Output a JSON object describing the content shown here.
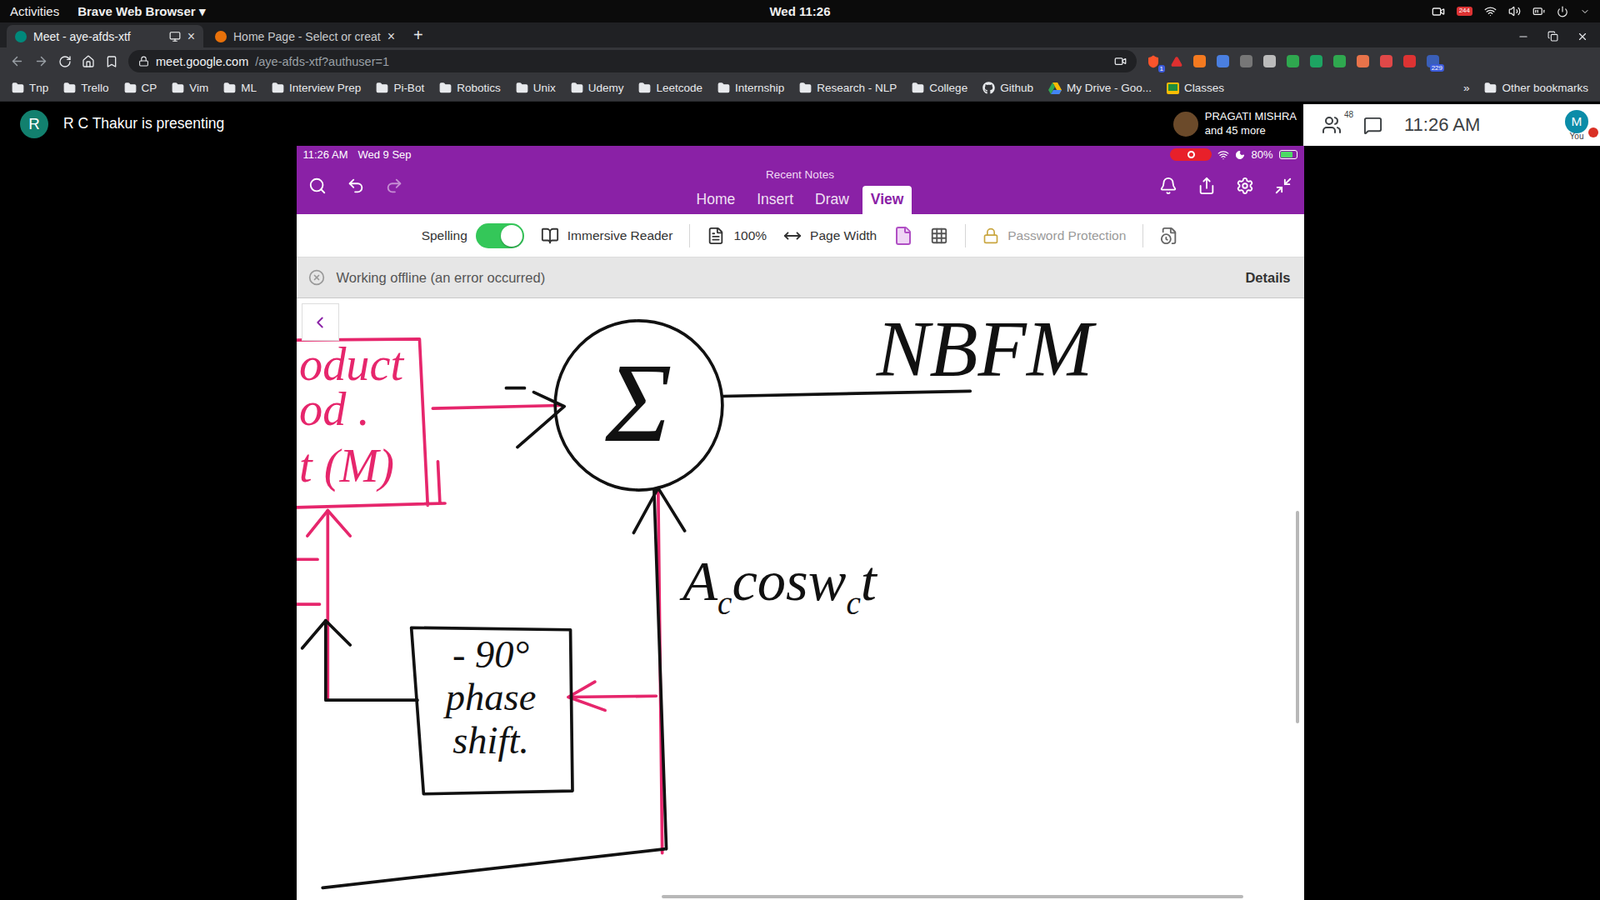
{
  "system_bar": {
    "activities": "Activities",
    "app_menu": "Brave Web Browser",
    "app_menu_arrow": "▾",
    "clock": "Wed 11:26",
    "notification_count": "244"
  },
  "browser": {
    "tabs": [
      {
        "label": "Meet - aye-afds-xtf",
        "selected": true,
        "close": "×"
      },
      {
        "label": "Home Page - Select or creat",
        "selected": false,
        "close": "×"
      }
    ],
    "new_tab": "+",
    "url": {
      "host": "meet.google.com",
      "path": "/aye-afds-xtf?authuser=1"
    },
    "shield_badge": "1",
    "extension_badge": "229",
    "bookmarks": [
      {
        "label": "Tnp",
        "kind": "folder"
      },
      {
        "label": "Trello",
        "kind": "folder"
      },
      {
        "label": "CP",
        "kind": "folder"
      },
      {
        "label": "Vim",
        "kind": "folder"
      },
      {
        "label": "ML",
        "kind": "folder"
      },
      {
        "label": "Interview Prep",
        "kind": "folder"
      },
      {
        "label": "Pi-Bot",
        "kind": "folder"
      },
      {
        "label": "Robotics",
        "kind": "folder"
      },
      {
        "label": "Unix",
        "kind": "folder"
      },
      {
        "label": "Udemy",
        "kind": "folder"
      },
      {
        "label": "Leetcode",
        "kind": "folder"
      },
      {
        "label": "Internship",
        "kind": "folder"
      },
      {
        "label": "Research - NLP",
        "kind": "folder"
      },
      {
        "label": "College",
        "kind": "folder"
      },
      {
        "label": "Github",
        "kind": "github"
      },
      {
        "label": "My Drive - Goo...",
        "kind": "drive"
      },
      {
        "label": "Classes",
        "kind": "classroom"
      }
    ],
    "overflow": "»",
    "other_bookmarks": "Other bookmarks"
  },
  "meet": {
    "presenter_initial": "R",
    "presenting": "R C Thakur is presenting",
    "participant_name": "PRAGATI MISHRA",
    "participant_more": "and 45 more",
    "people_count": "48",
    "clock": "11:26 AM",
    "self_initial": "M",
    "self_label": "You"
  },
  "onenote": {
    "status_time": "11:26 AM",
    "status_date": "Wed 9 Sep",
    "battery": "80%",
    "battery_level": 0.8,
    "notebook": "Recent Notes",
    "tabs": [
      {
        "label": "Home",
        "selected": false
      },
      {
        "label": "Insert",
        "selected": false
      },
      {
        "label": "Draw",
        "selected": false
      },
      {
        "label": "View",
        "selected": true
      }
    ],
    "ribbon": {
      "spelling": {
        "label": "Spelling",
        "on": true
      },
      "immersive_reader": "Immersive Reader",
      "zoom": "100%",
      "page_width": "Page Width",
      "password": {
        "label": "Password Protection",
        "disabled": true
      }
    },
    "banner": {
      "message": "Working offline (an error occurred)",
      "details": "Details"
    },
    "canvas": {
      "sum_symbol": "Σ",
      "output_label": "NBFM",
      "carrier": [
        {
          "text": "A",
          "sub": false
        },
        {
          "text": "c",
          "sub": true
        },
        {
          "text": "cos",
          "sub": false
        },
        {
          "text": "w",
          "sub": false
        },
        {
          "text": "c",
          "sub": true
        },
        {
          "text": "t",
          "sub": false
        }
      ],
      "phase_shift": [
        "- 90°",
        "phase",
        "shift."
      ],
      "product_box": [
        "oduct",
        "od .",
        "t (M)"
      ]
    }
  }
}
